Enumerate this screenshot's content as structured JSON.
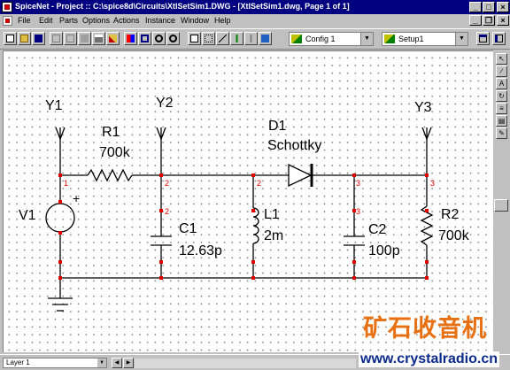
{
  "window": {
    "title": "SpiceNet - Project :: C:\\spice8d\\Circuits\\XtlSetSim1.DWG - [XtlSetSim1.dwg, Page 1 of 1]",
    "minimize": "_",
    "maximize": "□",
    "close": "×"
  },
  "menu": {
    "items": [
      "File",
      "Edit",
      "Parts",
      "Options",
      "Actions",
      "Instance",
      "Window",
      "Help"
    ],
    "mdi_minimize": "_",
    "mdi_restore": "❐",
    "mdi_close": "×"
  },
  "toolbar": {
    "config_value": "Config 1",
    "setup_value": "Setup1",
    "config_icon": "config-icon",
    "setup_icon": "setup-icon"
  },
  "schematic": {
    "probes": [
      "Y1",
      "Y2",
      "Y3"
    ],
    "components": {
      "V1": {
        "name": "V1",
        "polarity": "+"
      },
      "R1": {
        "name": "R1",
        "value": "700k"
      },
      "C1": {
        "name": "C1",
        "value": "12.63p"
      },
      "L1": {
        "name": "L1",
        "value": "2m"
      },
      "D1": {
        "name": "D1",
        "value": "Schottky"
      },
      "C2": {
        "name": "C2",
        "value": "100p"
      },
      "R2": {
        "name": "R2",
        "value": "700k"
      }
    },
    "nodes": {
      "n1": "1",
      "n2a": "2",
      "n2b": "2",
      "n2c": "2",
      "n3a": "3",
      "n3b": "3",
      "n3c": "3"
    },
    "wire_color": "#000000",
    "node_color": "#e00000",
    "junction_color": "#e00000"
  },
  "statusbar": {
    "layer": "Layer 1"
  },
  "watermark": {
    "chinese": "矿石收音机",
    "url": "www.crystalradio.cn"
  }
}
